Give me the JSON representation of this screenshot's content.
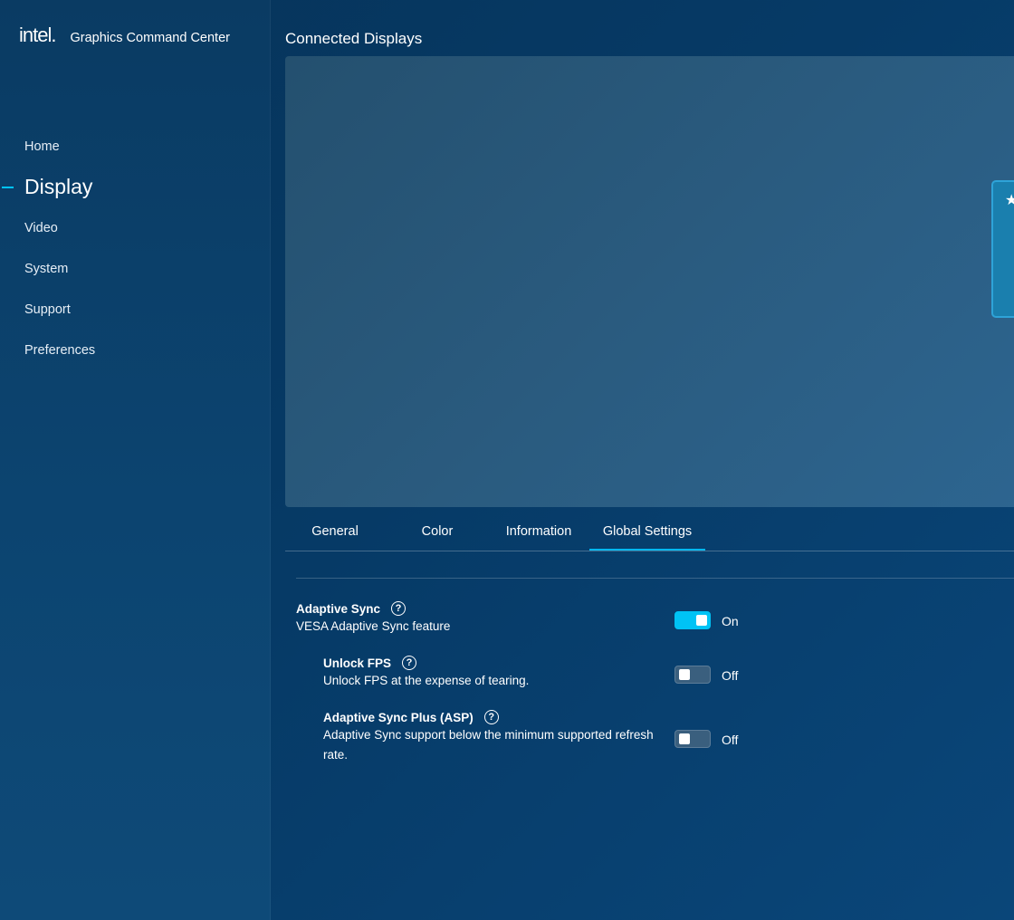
{
  "app": {
    "logo": "intel.",
    "title": "Graphics Command Center"
  },
  "nav": {
    "items": [
      {
        "label": "Home"
      },
      {
        "label": "Display"
      },
      {
        "label": "Video"
      },
      {
        "label": "System"
      },
      {
        "label": "Support"
      },
      {
        "label": "Preferences"
      }
    ],
    "active": "Display"
  },
  "main": {
    "section_title": "Connected Displays",
    "monitor_icon": "star-icon",
    "tabs": [
      {
        "label": "General"
      },
      {
        "label": "Color"
      },
      {
        "label": "Information"
      },
      {
        "label": "Global Settings"
      }
    ],
    "active_tab": "Global Settings"
  },
  "settings": {
    "adaptive_sync": {
      "title": "Adaptive Sync",
      "desc": "VESA Adaptive Sync feature",
      "state": "On"
    },
    "unlock_fps": {
      "title": "Unlock FPS",
      "desc": "Unlock FPS at the expense of tearing.",
      "state": "Off"
    },
    "asp": {
      "title": "Adaptive Sync Plus (ASP)",
      "desc": "Adaptive Sync support below the minimum supported refresh rate.",
      "state": "Off"
    }
  },
  "colors": {
    "accent": "#00c3f5",
    "background": "#063a66",
    "sidebar": "#0c4470"
  }
}
